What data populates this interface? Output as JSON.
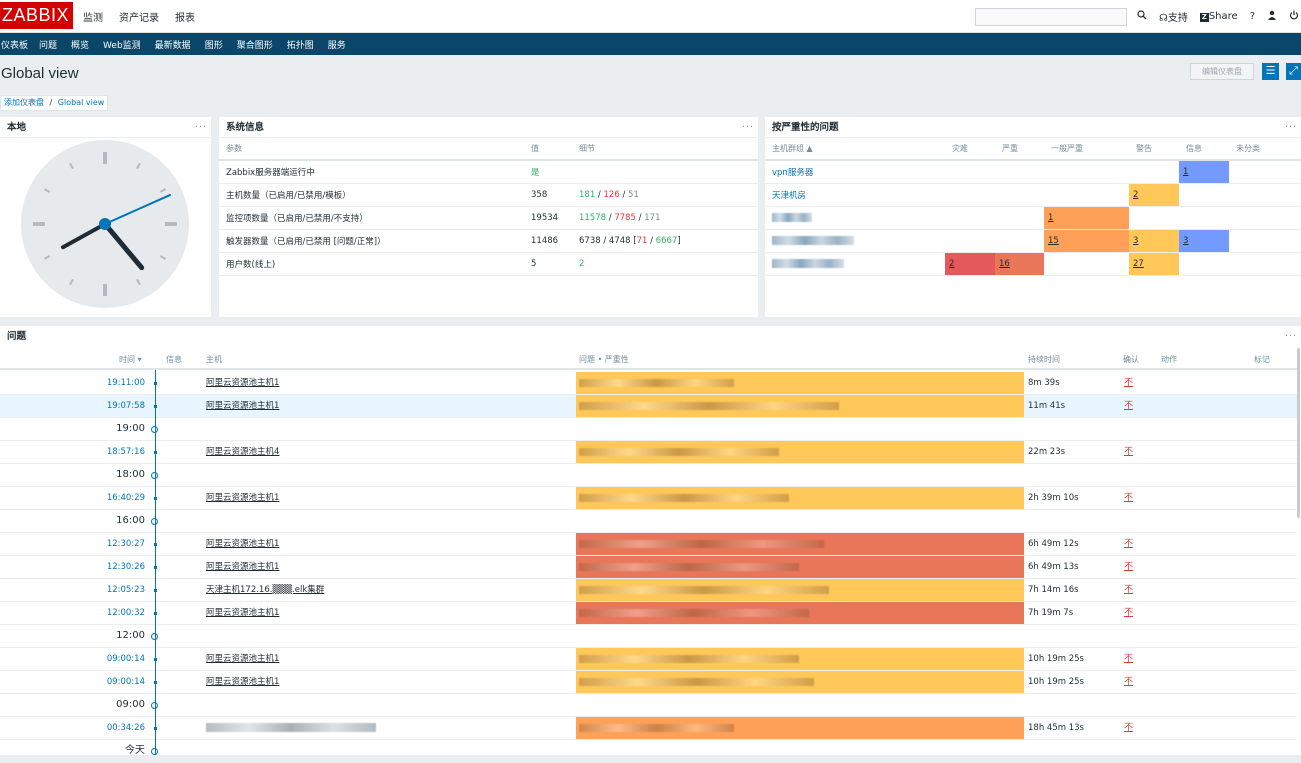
{
  "topbar": {
    "logo": "ZABBIX",
    "menu": [
      "监测",
      "资产记录",
      "报表"
    ],
    "support": "支持",
    "share": "Share",
    "help": "?"
  },
  "subnav": [
    "仪表板",
    "问题",
    "概览",
    "Web监测",
    "最新数据",
    "图形",
    "聚合图形",
    "拓扑图",
    "服务"
  ],
  "page": {
    "title": "Global view",
    "edit_button": "编辑仪表盘",
    "breadcrumb_link": "添加仪表盘",
    "breadcrumb_sep": "/",
    "breadcrumb_current": "Global view"
  },
  "clock_widget": {
    "title": "本地",
    "menu": "···",
    "time": {
      "hours": 4,
      "minutes": 40,
      "seconds": 11
    }
  },
  "sysinfo": {
    "title": "系统信息",
    "menu": "···",
    "headers": [
      "参数",
      "值",
      "细节"
    ],
    "rows": [
      {
        "param": "Zabbix服务器端运行中",
        "value": "是"
      },
      {
        "param": "主机数量（已启用/已禁用/模板）",
        "value": "358",
        "d1": "181",
        "d2": "126",
        "d3": "51"
      },
      {
        "param": "监控项数量（已启用/已禁用/不支持）",
        "value": "19534",
        "d1": "11578",
        "d2": "7785",
        "d3": "171"
      },
      {
        "param": "触发器数量（已启用/已禁用 [问题/正常]）",
        "value": "11486",
        "d1": "6738",
        "d2": "4748",
        "d3": "71",
        "d4": "6667"
      },
      {
        "param": "用户数(线上)",
        "value": "5",
        "d1": "2"
      }
    ]
  },
  "severity": {
    "title": "按严重性的问题",
    "menu": "···",
    "headers": [
      "主机群组 ▲",
      "灾难",
      "严重",
      "一般严重",
      "警告",
      "信息",
      "未分类"
    ],
    "rows": [
      {
        "group": "vpn服务器",
        "info": "1"
      },
      {
        "group": "天津机房",
        "warning": "2"
      },
      {
        "group": "",
        "average": "1"
      },
      {
        "group": "",
        "average": "15",
        "warning": "3",
        "info": "3"
      },
      {
        "group": "",
        "disaster": "2",
        "high": "16",
        "warning": "27"
      }
    ]
  },
  "problems": {
    "title": "问题",
    "menu": "···",
    "headers": {
      "time": "时间 ▾",
      "info": "信息",
      "host": "主机",
      "problem": "问题 • 严重性",
      "duration": "持续时间",
      "ack": "确认",
      "actions": "动作",
      "tags": "标记"
    },
    "rows": [
      {
        "time": "19:11:00",
        "host": "阿里云资源池主机1",
        "duration": "8m 39s",
        "ack": "不",
        "severity": "warning"
      },
      {
        "time": "19:07:58",
        "host": "阿里云资源池主机1",
        "duration": "11m 41s",
        "ack": "不",
        "severity": "warning",
        "selected": true
      },
      {
        "marker": "19:00"
      },
      {
        "time": "18:57:16",
        "host": "阿里云资源池主机4",
        "duration": "22m 23s",
        "ack": "不",
        "severity": "warning"
      },
      {
        "marker": "18:00"
      },
      {
        "time": "16:40:29",
        "host": "阿里云资源池主机1",
        "duration": "2h 39m 10s",
        "ack": "不",
        "severity": "warning"
      },
      {
        "marker": "16:00"
      },
      {
        "time": "12:30:27",
        "host": "阿里云资源池主机1",
        "duration": "6h 49m 12s",
        "ack": "不",
        "severity": "high"
      },
      {
        "time": "12:30:26",
        "host": "阿里云资源池主机1",
        "duration": "6h 49m 13s",
        "ack": "不",
        "severity": "high"
      },
      {
        "time": "12:05:23",
        "host": "天津主机172.16.▒▒▒.elk集群",
        "duration": "7h 14m 16s",
        "ack": "不",
        "severity": "warning"
      },
      {
        "time": "12:00:32",
        "host": "阿里云资源池主机1",
        "duration": "7h 19m 7s",
        "ack": "不",
        "severity": "high"
      },
      {
        "marker": "12:00"
      },
      {
        "time": "09:00:14",
        "host": "阿里云资源池主机1",
        "duration": "10h 19m 25s",
        "ack": "不",
        "severity": "warning"
      },
      {
        "time": "09:00:14",
        "host": "阿里云资源池主机1",
        "duration": "10h 19m 25s",
        "ack": "不",
        "severity": "warning"
      },
      {
        "marker": "09:00"
      },
      {
        "time": "00:34:26",
        "host": "",
        "duration": "18h 45m 13s",
        "ack": "不",
        "severity": "average"
      },
      {
        "marker": "今天"
      }
    ]
  },
  "colors": {
    "disaster": "#e45959",
    "high": "#e97659",
    "average": "#ffa059",
    "warning": "#ffc859",
    "info": "#7499ff",
    "nav": "#0a466a",
    "accent": "#0275b8"
  }
}
